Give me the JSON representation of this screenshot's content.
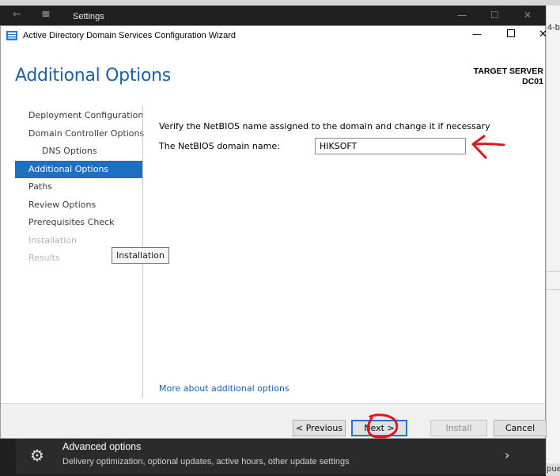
{
  "settings_window": {
    "title": "Settings",
    "back_glyph": "←",
    "menu_glyph": "≡",
    "min_glyph": "—",
    "max_glyph": "☐",
    "close_glyph": "✕",
    "advanced_options": {
      "title": "Advanced options",
      "description": "Delivery optimization, optional updates, active hours, other update settings",
      "icon": "gears-icon",
      "chevron": "›"
    }
  },
  "right_fragments": {
    "top_text": "4-b",
    "bottom_text": "pue"
  },
  "wizard": {
    "title": "Active Directory Domain Services Configuration Wizard",
    "min_glyph": "—",
    "close_glyph": "✕",
    "page_title": "Additional Options",
    "target_server_label": "TARGET SERVER",
    "target_server_name": "DC01",
    "nav": [
      {
        "label": "Deployment Configuration",
        "state": "normal"
      },
      {
        "label": "Domain Controller Options",
        "state": "normal"
      },
      {
        "label": "DNS Options",
        "state": "sub"
      },
      {
        "label": "Additional Options",
        "state": "active"
      },
      {
        "label": "Paths",
        "state": "normal"
      },
      {
        "label": "Review Options",
        "state": "normal"
      },
      {
        "label": "Prerequisites Check",
        "state": "normal"
      },
      {
        "label": "Installation",
        "state": "disabled"
      },
      {
        "label": "Results",
        "state": "disabled"
      }
    ],
    "tooltip": "Installation",
    "instruction": "Verify the NetBIOS name assigned to the domain and change it if necessary",
    "netbios_label": "The NetBIOS domain name:",
    "netbios_value": "HIKSOFT",
    "more_link": "More about additional options",
    "buttons": {
      "previous": "< Previous",
      "next": "Next >",
      "install": "Install",
      "cancel": "Cancel"
    }
  },
  "colors": {
    "accent": "#1f6fbf",
    "title_blue": "#1f5fa8",
    "annotation_red": "#e0161b",
    "settings_dark": "#1f1f1f"
  }
}
